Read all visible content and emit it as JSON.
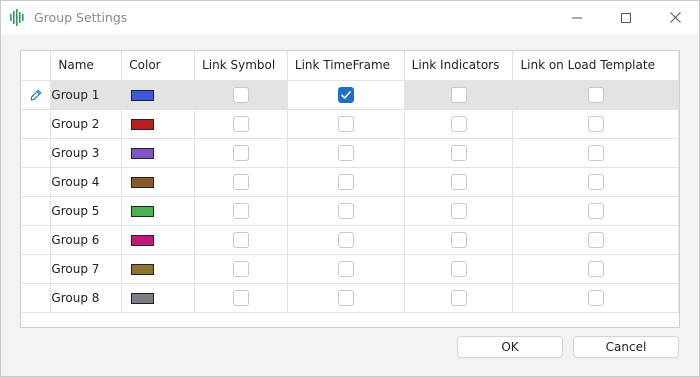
{
  "window": {
    "title": "Group Settings"
  },
  "grid": {
    "columns": [
      "Name",
      "Color",
      "Link Symbol",
      "Link TimeFrame",
      "Link Indicators",
      "Link on Load Template"
    ],
    "rows": [
      {
        "name": "Group 1",
        "color": "#3b5bdb",
        "link_symbol": false,
        "link_timeframe": true,
        "link_indicators": false,
        "link_template": false
      },
      {
        "name": "Group 2",
        "color": "#b52020",
        "link_symbol": false,
        "link_timeframe": false,
        "link_indicators": false,
        "link_template": false
      },
      {
        "name": "Group 3",
        "color": "#7e57c2",
        "link_symbol": false,
        "link_timeframe": false,
        "link_indicators": false,
        "link_template": false
      },
      {
        "name": "Group 4",
        "color": "#8b5a2b",
        "link_symbol": false,
        "link_timeframe": false,
        "link_indicators": false,
        "link_template": false
      },
      {
        "name": "Group 5",
        "color": "#4caf50",
        "link_symbol": false,
        "link_timeframe": false,
        "link_indicators": false,
        "link_template": false
      },
      {
        "name": "Group 6",
        "color": "#c2187a",
        "link_symbol": false,
        "link_timeframe": false,
        "link_indicators": false,
        "link_template": false
      },
      {
        "name": "Group 7",
        "color": "#8d7230",
        "link_symbol": false,
        "link_timeframe": false,
        "link_indicators": false,
        "link_template": false
      },
      {
        "name": "Group 8",
        "color": "#7d7d86",
        "link_symbol": false,
        "link_timeframe": false,
        "link_indicators": false,
        "link_template": false
      }
    ]
  },
  "buttons": {
    "ok": "OK",
    "cancel": "Cancel"
  },
  "icons": {
    "app": "audio-wave-icon",
    "minimize": "minimize-icon",
    "maximize": "maximize-icon",
    "close": "close-icon",
    "edit": "pencil-icon"
  },
  "colors": {
    "accent": "#1f6fc4",
    "selected_row": "#e3e3e3"
  }
}
